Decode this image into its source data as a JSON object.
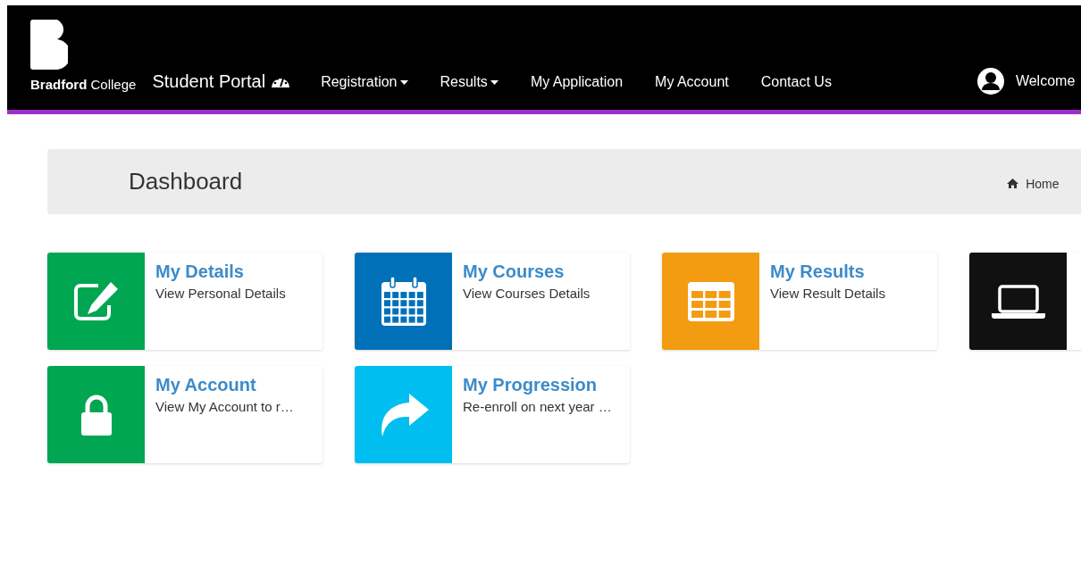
{
  "header": {
    "logo_text": {
      "bold": "Bradford",
      "rest": "College"
    },
    "portal_title": "Student Portal",
    "nav": [
      {
        "label": "Registration",
        "dropdown": true
      },
      {
        "label": "Results",
        "dropdown": true
      },
      {
        "label": "My Application",
        "dropdown": false
      },
      {
        "label": "My Account",
        "dropdown": false
      },
      {
        "label": "Contact Us",
        "dropdown": false
      }
    ],
    "welcome": "Welcome"
  },
  "page_title": "Dashboard",
  "breadcrumb": {
    "home": "Home"
  },
  "tiles": [
    {
      "kind": "edit",
      "color": "#00a651",
      "title": "My Details",
      "subtitle": "View Personal Details"
    },
    {
      "kind": "calendar",
      "color": "#0071b9",
      "title": "My Courses",
      "subtitle": "View Courses Details"
    },
    {
      "kind": "grid",
      "color": "#f39c12",
      "title": "My Results",
      "subtitle": "View Result Details"
    },
    {
      "kind": "laptop",
      "color": "#111111"
    },
    {
      "kind": "lock",
      "color": "#00a651",
      "title": "My Account",
      "subtitle": "View My Account to r…"
    },
    {
      "kind": "share",
      "color": "#00bff0",
      "title": "My Progression",
      "subtitle": "Re-enroll on next year …"
    }
  ]
}
